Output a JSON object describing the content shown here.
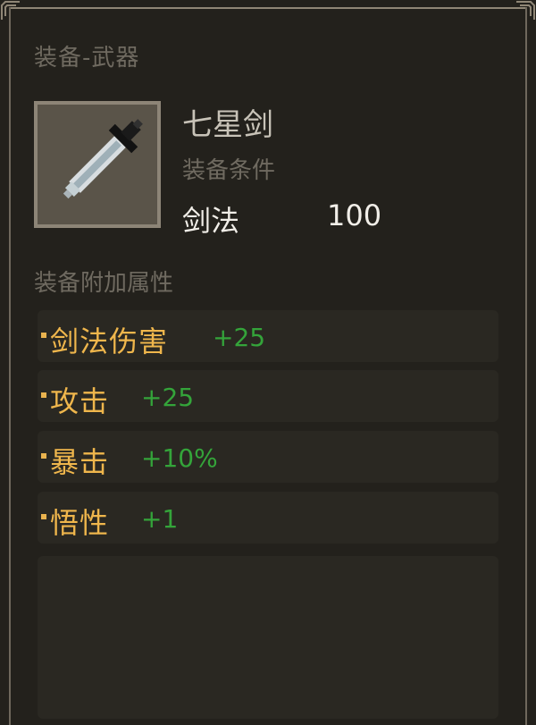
{
  "category_label": "装备-武器",
  "item": {
    "name": "七星剑",
    "icon": "sword-icon",
    "requirement_title": "装备条件",
    "requirement": {
      "name": "剑法",
      "value": "100"
    }
  },
  "attributes_title": "装备附加属性",
  "attributes": [
    {
      "name": "剑法伤害",
      "value": "+25"
    },
    {
      "name": "攻击",
      "value": "+25"
    },
    {
      "name": "暴击",
      "value": "+10%"
    },
    {
      "name": "悟性",
      "value": "+1"
    }
  ],
  "colors": {
    "panel_bg": "#23211c",
    "muted_text": "#6f6a60",
    "attr_name": "#efb64c",
    "attr_value": "#34a43a",
    "main_text": "#f1eee8"
  }
}
